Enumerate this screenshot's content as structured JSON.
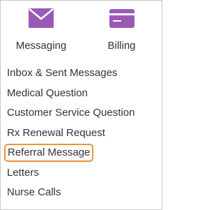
{
  "nav": {
    "messaging": {
      "label": "Messaging",
      "icon": "envelope-icon"
    },
    "billing": {
      "label": "Billing",
      "icon": "credit-card-icon"
    },
    "accent_color": "#9b59b6"
  },
  "menu": {
    "items": [
      {
        "label": "Inbox & Sent Messages"
      },
      {
        "label": "Medical Question"
      },
      {
        "label": "Customer Service Question"
      },
      {
        "label": "Rx Renewal Request"
      },
      {
        "label": "Referral Message",
        "highlighted": true
      },
      {
        "label": "Letters"
      },
      {
        "label": "Nurse Calls"
      }
    ],
    "highlight_color": "#e8943a"
  }
}
